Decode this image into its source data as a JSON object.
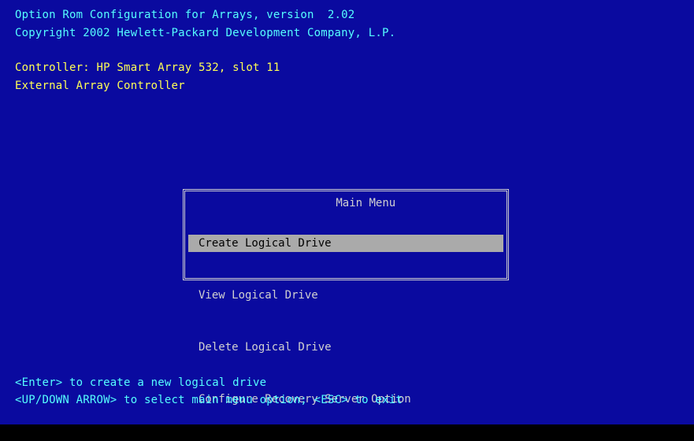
{
  "header": {
    "title_line": "Option Rom Configuration for Arrays, version  2.02",
    "copyright_line": "Copyright 2002 Hewlett-Packard Development Company, L.P."
  },
  "controller": {
    "name_line": "Controller: HP Smart Array 532, slot 11",
    "type_line": "External Array Controller"
  },
  "main_menu": {
    "title": "Main Menu",
    "items": [
      {
        "label": "Create Logical Drive",
        "selected": true
      },
      {
        "label": "View Logical Drive",
        "selected": false
      },
      {
        "label": "Delete Logical Drive",
        "selected": false
      },
      {
        "label": "Configure Recovery Server Option",
        "selected": false
      }
    ]
  },
  "footer": {
    "hint_line": "<Enter> to create a new logical drive",
    "keys_line": "<UP/DOWN ARROW> to select main menu option; <ESC> to exit"
  },
  "colors": {
    "background": "#0a0a9f",
    "info_text": "#55ffff",
    "controller_text": "#ffff55",
    "menu_text": "#d0d0d0",
    "selection_bar": "#aaaaaa"
  }
}
